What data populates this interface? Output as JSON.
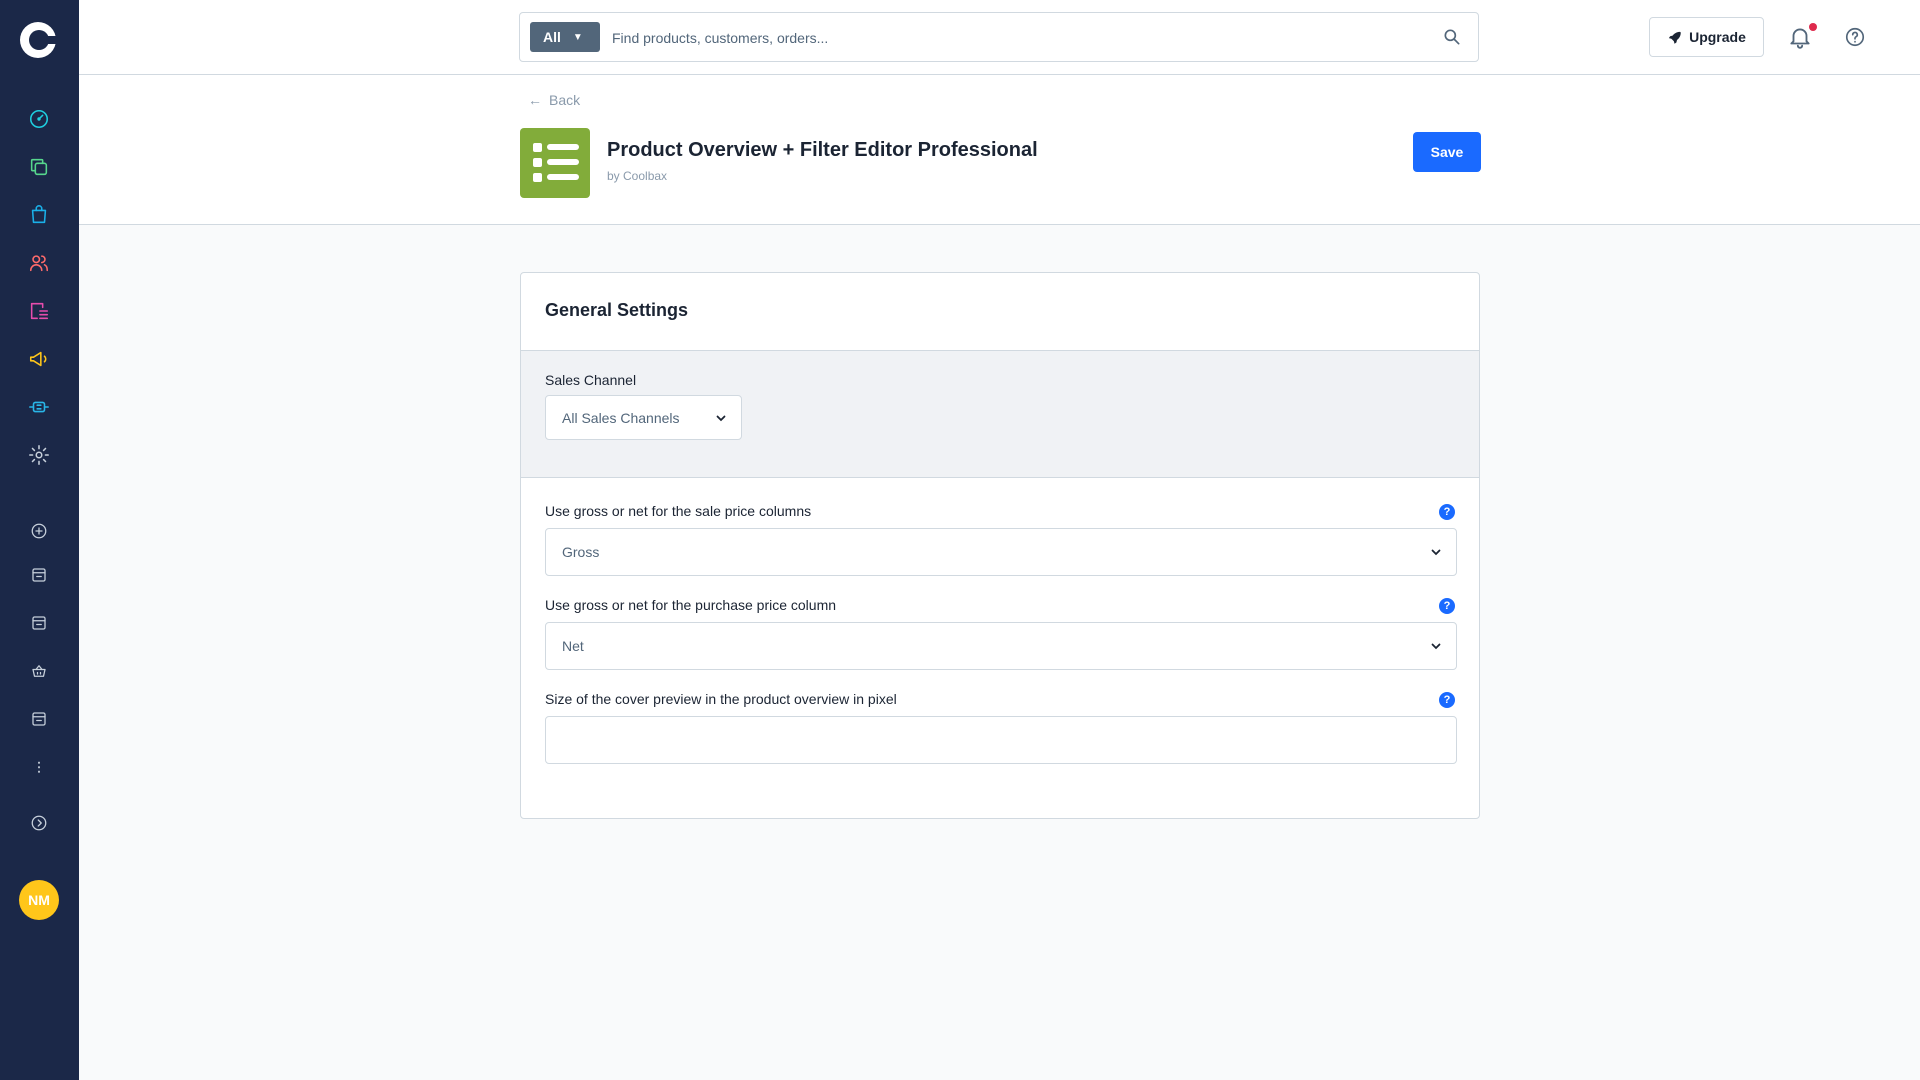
{
  "sidebar": {
    "nav_icons": [
      "dashboard-icon",
      "catalogue-icon",
      "orders-icon",
      "customers-icon",
      "content-icon",
      "marketing-icon",
      "extensions-icon",
      "settings-icon"
    ],
    "sales_channel_icons": [
      "add-sales-channel-icon",
      "storefront-icon",
      "storefront-icon",
      "headless-icon",
      "storefront-icon"
    ],
    "more_icon": "more-icon",
    "expand_icon": "expand-icon",
    "avatar_initials": "NM",
    "colors": {
      "background": "#1b2848",
      "dashboard": "#1ecfe0",
      "catalogue": "#56d68d",
      "orders": "#1ab0e8",
      "customers": "#ff6b6b",
      "content": "#e64cad",
      "marketing": "#ffc61a",
      "extensions": "#29b6e8",
      "muted": "#c7d0db"
    }
  },
  "topbar": {
    "search_type": "All",
    "search_placeholder": "Find products, customers, orders...",
    "upgrade_label": "Upgrade",
    "icons": [
      "search-icon",
      "rocket-icon",
      "bell-icon",
      "help-icon"
    ]
  },
  "header": {
    "back_label": "Back",
    "plugin_title": "Product Overview + Filter Editor Professional",
    "plugin_by": "by Coolbax",
    "save_label": "Save",
    "plugin_icon_color": "#82ac3a",
    "accent": "#1a6aff"
  },
  "settings": {
    "card_title": "General Settings",
    "sales_channel_label": "Sales Channel",
    "sales_channel_value": "All Sales Channels",
    "sale_price_label": "Use gross or net for the sale price columns",
    "sale_price_value": "Gross",
    "purchase_price_label": "Use gross or net for the purchase price column",
    "purchase_price_value": "Net",
    "cover_size_label": "Size of the cover preview in the product overview in pixel",
    "cover_size_value": "",
    "help_glyph": "?"
  }
}
